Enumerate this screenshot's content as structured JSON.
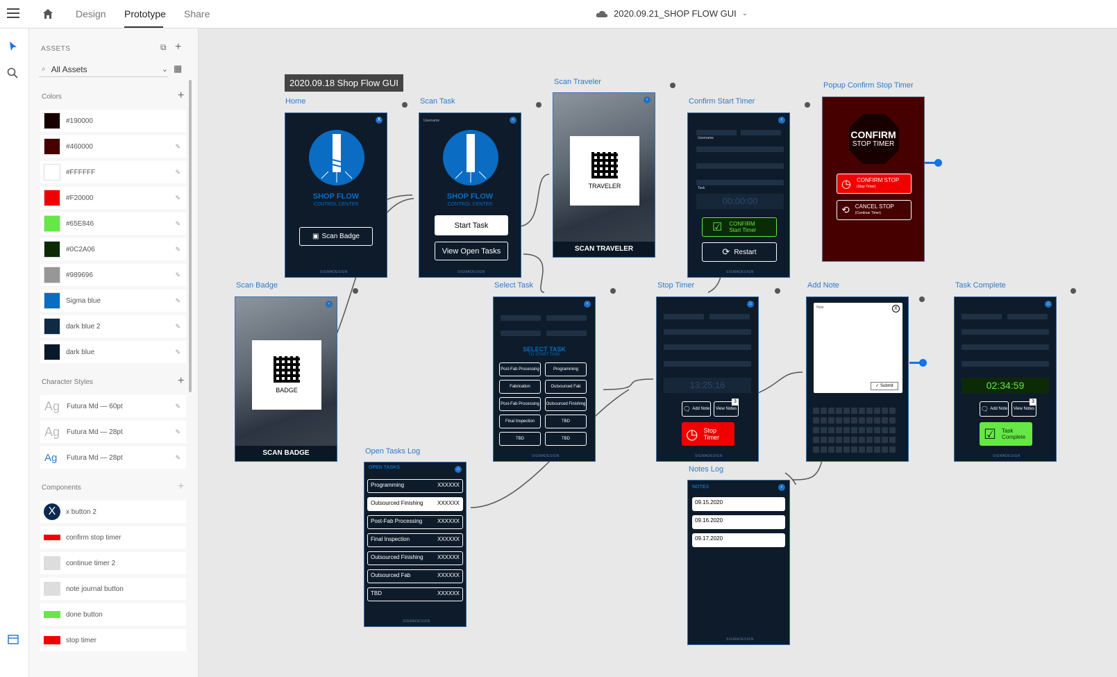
{
  "topbar": {
    "tabs": [
      "Design",
      "Prototype",
      "Share"
    ],
    "active_tab": "Prototype",
    "doc_title": "2020.09.21_SHOP FLOW GUI"
  },
  "assets": {
    "header": "ASSETS",
    "filter": "All Assets",
    "colors_title": "Colors",
    "colors": [
      {
        "label": "#190000",
        "hex": "#190000"
      },
      {
        "label": "#460000",
        "hex": "#460000"
      },
      {
        "label": "#FFFFFF",
        "hex": "#FFFFFF"
      },
      {
        "label": "#F20000",
        "hex": "#F20000"
      },
      {
        "label": "#65E846",
        "hex": "#65E846"
      },
      {
        "label": "#0C2A06",
        "hex": "#0C2A06"
      },
      {
        "label": "#989696",
        "hex": "#989696"
      },
      {
        "label": "Sigma blue",
        "hex": "#0a6cc2"
      },
      {
        "label": "dark blue 2",
        "hex": "#0f2a44"
      },
      {
        "label": "dark blue",
        "hex": "#08192a"
      }
    ],
    "char_title": "Character Styles",
    "char_styles": [
      "Futura Md — 60pt",
      "Futura Md — 28pt",
      "Futura Md — 28pt"
    ],
    "char_sample": "Ag",
    "comp_title": "Components",
    "components": [
      "x button 2",
      "confirm stop timer",
      "continue timer 2",
      "note journal button",
      "done button",
      "stop timer"
    ]
  },
  "canvas": {
    "group_title": "2020.09.18 Shop Flow GUI",
    "artboards": {
      "home": "Home",
      "scan_task": "Scan Task",
      "scan_traveler": "Scan Traveler",
      "confirm_start": "Confirm Start Timer",
      "popup_confirm": "Popup Confirm Stop Timer",
      "scan_badge": "Scan Badge",
      "select_task": "Select Task",
      "stop_timer": "Stop Timer",
      "add_note": "Add Note",
      "task_complete": "Task Complete",
      "open_tasks_log": "Open Tasks Log",
      "notes_log": "Notes Log"
    },
    "home": {
      "logo1": "SHOP FLOW",
      "logo2": "CONTROL CENTER",
      "btn": "Scan Badge",
      "brand": "SIGMADESIGN"
    },
    "scan_task": {
      "user": "Username",
      "btn1": "Start Task",
      "btn2": "View Open Tasks"
    },
    "scan_traveler": {
      "qr_label": "TRAVELER",
      "footer": "SCAN TRAVELER"
    },
    "scan_badge": {
      "qr_label": "BADGE",
      "footer": "SCAN BADGE"
    },
    "confirm_start": {
      "timer": "00:00:00",
      "btn_confirm1": "CONFIRM",
      "btn_confirm2": "Start Timer",
      "btn_restart": "Restart",
      "f_user": "Username",
      "f_task": "Task"
    },
    "popup": {
      "title1": "CONFIRM",
      "title2": "STOP TIMER",
      "btn1": "CONFIRM STOP",
      "btn1_sub": "(Stop Timer)",
      "btn2": "CANCEL STOP",
      "btn2_sub": "(Continue Timer)"
    },
    "select_task": {
      "title1": "SELECT TASK",
      "title2": "TO START TASK",
      "tasks_left": [
        "Post-Fab Processing",
        "Fabrication",
        "Post-Fab Processing",
        "Final Inspection",
        "TBD"
      ],
      "tasks_right": [
        "Programming",
        "Outsourced Fab",
        "Outsourced Finishing",
        "TBD",
        "TBD"
      ]
    },
    "stop_timer": {
      "timer": "13:25:16",
      "add_note": "Add Note",
      "view_notes": "View Notes",
      "badge": "3",
      "stop1": "Stop",
      "stop2": "Timer"
    },
    "add_note": {
      "note_label": "Note",
      "submit": "Submit"
    },
    "task_complete": {
      "timer": "02:34:59",
      "badge": "3",
      "done1": "Task",
      "done2": "Complete"
    },
    "open_tasks": {
      "title": "OPEN TASKS",
      "items": [
        {
          "name": "Programming",
          "id": "XXXXXX"
        },
        {
          "name": "Outsourced Finishing",
          "id": "XXXXXX"
        },
        {
          "name": "Post-Fab Processing",
          "id": "XXXXXX"
        },
        {
          "name": "Final Inspection",
          "id": "XXXXXX"
        },
        {
          "name": "Outsourced Finishing",
          "id": "XXXXXX"
        },
        {
          "name": "Outsourced Fab",
          "id": "XXXXXX"
        },
        {
          "name": "TBD",
          "id": "XXXXXX"
        }
      ]
    },
    "notes_log": {
      "title": "NOTES",
      "dates": [
        "09.15.2020",
        "09.16.2020",
        "09.17.2020"
      ]
    }
  }
}
